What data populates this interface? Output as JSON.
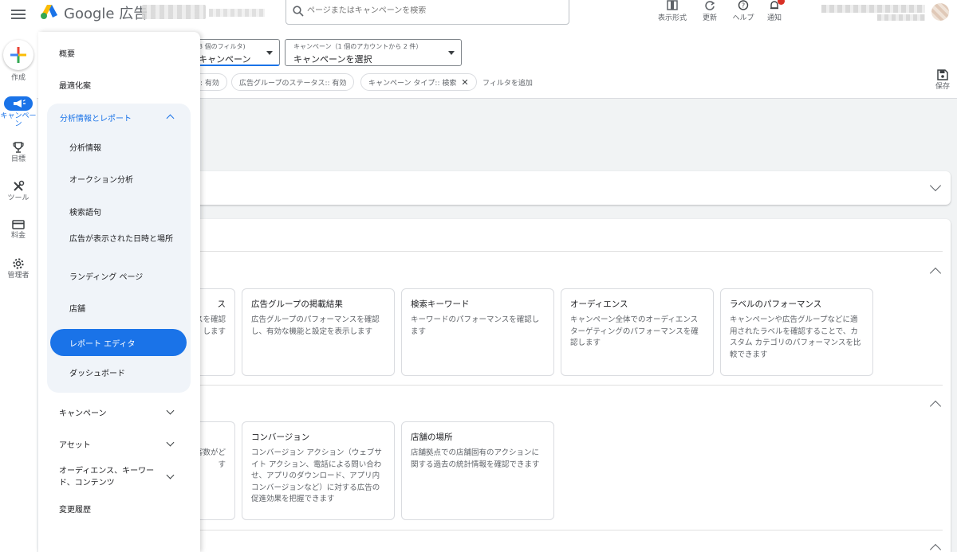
{
  "app": {
    "brand": "Google 広告",
    "search_placeholder": "ページまたはキャンペーンを検索"
  },
  "toolbar": {
    "items": [
      {
        "label": "表示形式",
        "icon": "view-icon"
      },
      {
        "label": "更新",
        "icon": "refresh-icon"
      },
      {
        "label": "ヘルプ",
        "icon": "help-icon"
      },
      {
        "label": "通知",
        "icon": "bell-icon"
      }
    ]
  },
  "rail": {
    "create": "作成",
    "campaign": "キャンペーン",
    "goals": "目標",
    "tools": "ツール",
    "billing": "料金",
    "admin": "管理者"
  },
  "filters": {
    "view_small": "3 個のフィルタ)",
    "view_value": "キャンペーン",
    "campaign_small": "キャンペーン（1 個のアカウントから 2 件）",
    "campaign_value": "キャンペーンを選択",
    "chips": [
      {
        "label": ": 有効"
      },
      {
        "label": "広告グループのステータス:: 有効"
      },
      {
        "label": "キャンペーン タイプ:: 検索"
      }
    ],
    "add_filter": "フィルタを追加",
    "save": "保存"
  },
  "drawer": {
    "overview": "概要",
    "recommendations": "最適化案",
    "insights_group": "分析情報とレポート",
    "insights_items": [
      "分析情報",
      "オークション分析",
      "検索語句",
      "広告が表示された日時と場所",
      "ランディング ページ",
      "店舗",
      "レポート エディタ",
      "ダッシュボード"
    ],
    "campaigns": "キャンペーン",
    "assets": "アセット",
    "audiences": "オーディエンス、キーワード、コンテンツ",
    "change_history": "変更履歴"
  },
  "tiles_row1": [
    {
      "title": "ス",
      "desc": "スを確認\nします"
    },
    {
      "title": "広告グループの掲載結果",
      "desc": "広告グループのパフォーマンスを確認し、有効な機能と設定を表示します"
    },
    {
      "title": "検索キーワード",
      "desc": "キーワードのパフォーマンスを確認します"
    },
    {
      "title": "オーディエンス",
      "desc": "キャンペーン全体でのオーディエンスターゲティングのパフォーマンスを確認します"
    },
    {
      "title": "ラベルのパフォーマンス",
      "desc": "キャンペーンや広告グループなどに適用されたラベルを確認することで、カスタム カテゴリのパフォーマンスを比較できます"
    }
  ],
  "tiles_row2": [
    {
      "title": "",
      "desc": "客数がど\nす"
    },
    {
      "title": "コンバージョン",
      "desc": "コンバージョン アクション（ウェブサイト アクション、電話による問い合わせ、アプリのダウンロード、アプリ内コンバージョンなど）に対する広告の促進効果を把握できます"
    },
    {
      "title": "店舗の場所",
      "desc": "店舗拠点での店舗固有のアクションに関する過去の統計情報を確認できます"
    }
  ],
  "colors": {
    "accent": "#1a73e8",
    "notification": "#d93025"
  }
}
